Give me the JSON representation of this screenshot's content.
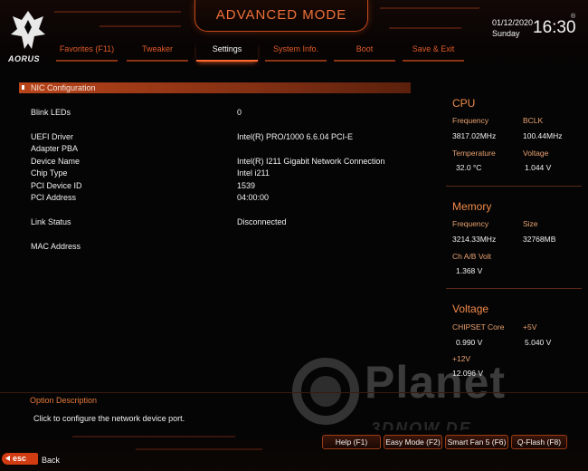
{
  "header": {
    "mode_title": "ADVANCED MODE",
    "brand": "AORUS",
    "date": "01/12/2020",
    "day": "Sunday",
    "time": "16:30",
    "reg_mark": "®"
  },
  "tabs": [
    {
      "label": "Favorites (F11)",
      "active": false
    },
    {
      "label": "Tweaker",
      "active": false
    },
    {
      "label": "Settings",
      "active": true
    },
    {
      "label": "System Info.",
      "active": false
    },
    {
      "label": "Boot",
      "active": false
    },
    {
      "label": "Save & Exit",
      "active": false
    }
  ],
  "section": {
    "title": "NIC Configuration"
  },
  "rows": [
    {
      "label": "Blink LEDs",
      "value": "0"
    },
    {
      "label": "UEFI Driver",
      "value": "Intel(R) PRO/1000 6.6.04 PCI-E"
    },
    {
      "label": "Adapter PBA",
      "value": ""
    },
    {
      "label": "Device Name",
      "value": "Intel(R) I211 Gigabit  Network Connection"
    },
    {
      "label": "Chip Type",
      "value": "Intel i211"
    },
    {
      "label": "PCI Device ID",
      "value": "1539"
    },
    {
      "label": "PCI Address",
      "value": "04:00:00"
    },
    {
      "label": "Link Status",
      "value": "Disconnected"
    },
    {
      "label": "MAC Address",
      "value": ""
    }
  ],
  "sidebar": {
    "cpu": {
      "title": "CPU",
      "frequency_label": "Frequency",
      "frequency": "3817.02MHz",
      "bclk_label": "BCLK",
      "bclk": "100.44MHz",
      "temperature_label": "Temperature",
      "temperature": "32.0 °C",
      "voltage_label": "Voltage",
      "voltage": "1.044 V"
    },
    "memory": {
      "title": "Memory",
      "frequency_label": "Frequency",
      "frequency": "3214.33MHz",
      "size_label": "Size",
      "size": "32768MB",
      "volt_label": "Ch A/B Volt",
      "volt": "1.368 V"
    },
    "voltage": {
      "title": "Voltage",
      "chipset_label": "CHIPSET Core",
      "chipset": "0.990 V",
      "p5v_label": "+5V",
      "p5v": "5.040 V",
      "p12v_label": "+12V",
      "p12v": "12.096 V"
    }
  },
  "option": {
    "title": "Option Description",
    "text": "Click to configure the network device port."
  },
  "footer": {
    "esc_label": "esc",
    "back_label": "Back",
    "buttons": [
      {
        "label": "Help (F1)"
      },
      {
        "label": "Easy Mode (F2)"
      },
      {
        "label": "Smart Fan 5 (F6)"
      },
      {
        "label": "Q-Flash (F8)"
      }
    ]
  },
  "watermark": {
    "text": "Planet",
    "sub": "3DNOW.DE"
  },
  "colors": {
    "accent": "#e05a26",
    "section_bar": "#b8441a",
    "background": "#050505"
  }
}
